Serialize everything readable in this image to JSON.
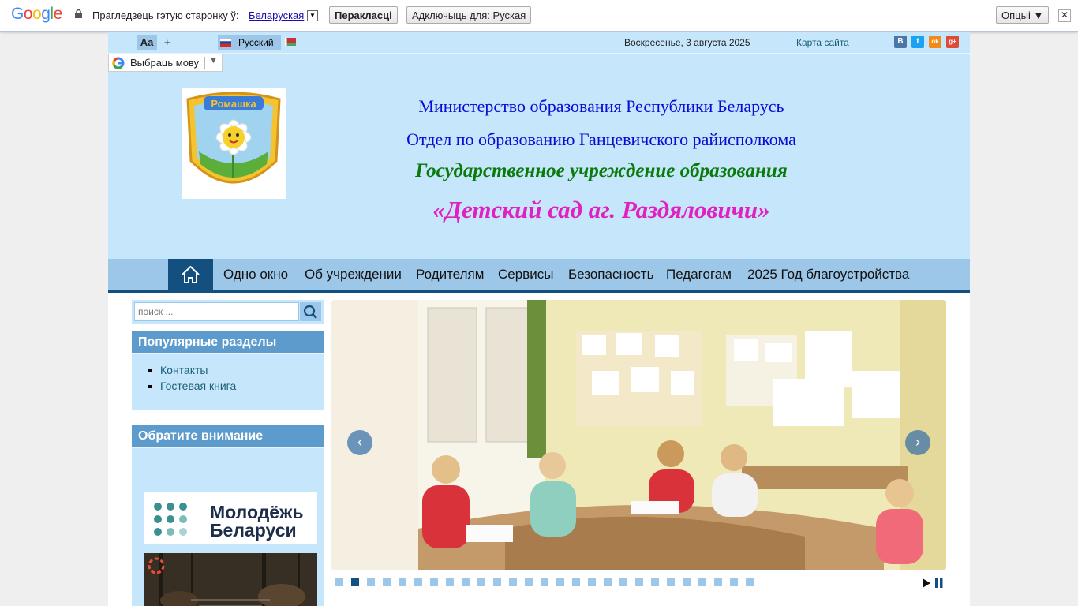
{
  "translate_bar": {
    "logo": "Google",
    "prompt": "Прагледзець гэтую старонку ў:",
    "language": "Беларуская",
    "translate_button": "Перакласці",
    "disable_button": "Адключыць для: Руская",
    "options_button": "Опцыі ▼",
    "close": "✕"
  },
  "top_strip": {
    "font_minus": "-",
    "font_normal": "Aa",
    "font_plus": "+",
    "language": "Русский",
    "date": "Воскресенье, 3 августа 2025",
    "sitemap": "Карта сайта",
    "social": [
      "В",
      "t",
      "ok",
      "g+"
    ]
  },
  "google_select": {
    "label": "Выбраць мову",
    "arrow": "▼"
  },
  "header": {
    "line1": "Министерство образования Республики Беларусь",
    "line2": "Отдел по образованию Ганцевичского райисполкома",
    "line3": "Государственное учреждение образования",
    "line4": "«Детский сад аг. Раздяловичи»",
    "logo_text": "Ромашка"
  },
  "nav": {
    "items": [
      "Одно окно",
      "Об учреждении",
      "Родителям",
      "Сервисы",
      "Безопасность",
      "Педагогам",
      "2025 Год благоустройства"
    ]
  },
  "sidebar": {
    "search_placeholder": "поиск ...",
    "popular_title": "Популярные разделы",
    "popular_items": [
      "Контакты",
      "Гостевая книга"
    ],
    "attention_title": "Обратите внимание",
    "banner1_line1": "Молодёжь",
    "banner1_line2": "Беларуси"
  },
  "slider": {
    "prev": "‹",
    "next": "›",
    "dot_count": 27,
    "active_dot": 1
  },
  "colors": {
    "accent": "#13507f",
    "nav_bg": "#9dc7e8",
    "header_bg": "#c5e6fb",
    "panel_title": "#5c9bcc"
  }
}
